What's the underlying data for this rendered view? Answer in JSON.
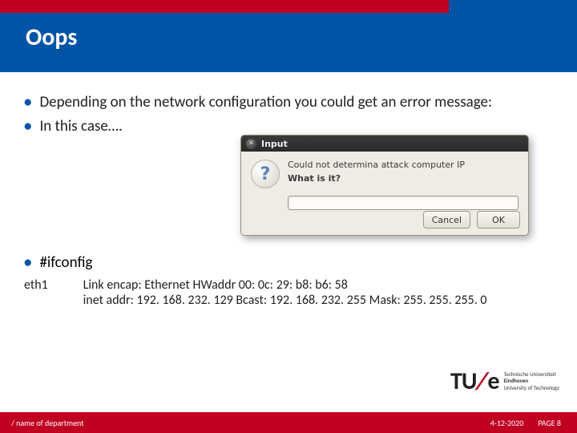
{
  "header": {
    "title": "Oops"
  },
  "bullets": {
    "b1": "Depending on the network configuration you could get an error message:",
    "b2": "In this case….",
    "b3": "#ifconfig"
  },
  "dialog": {
    "title": "Input",
    "line1": "Could not determina attack computer IP",
    "line2": "What is it?",
    "input_value": "",
    "input_placeholder": "",
    "cancel": "Cancel",
    "ok": "OK",
    "close_glyph": "✕",
    "question_glyph": "?"
  },
  "ifconfig": {
    "iface": "eth1",
    "row1": "Link encap: Ethernet  HWaddr 00: 0c: 29: b8: b6: 58",
    "row2": "inet addr: 192. 168. 232. 129  Bcast: 192. 168. 232. 255  Mask: 255. 255. 255. 0"
  },
  "logo": {
    "tu": "TU",
    "e": "e",
    "txt1": "Technische Universiteit",
    "txt2": "Eindhoven",
    "txt3": "University of Technology"
  },
  "footer": {
    "dept": "/ name of department",
    "date": "4-12-2020",
    "page": "PAGE 8"
  }
}
